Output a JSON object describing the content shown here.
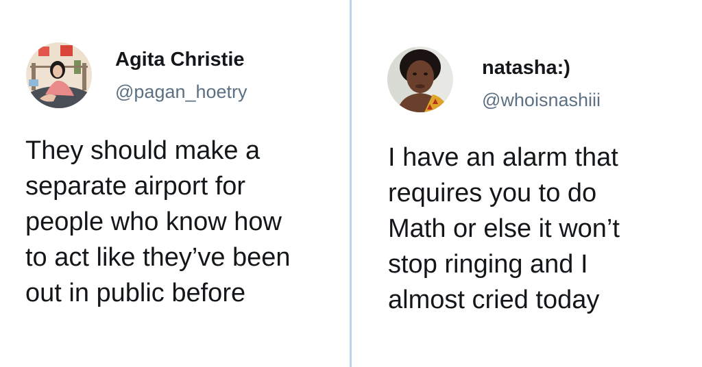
{
  "tweets": [
    {
      "display_name": "Agita Christie",
      "handle": "@pagan_hoetry",
      "avatar_icon": "profile-photo",
      "text_lines": [
        "They should make a",
        "separate airport for",
        "people who know how",
        "to act like they’ve been",
        "out in public before"
      ]
    },
    {
      "display_name": "natasha:)",
      "handle": "@whoisnashiii",
      "avatar_icon": "profile-photo",
      "text_lines": [
        "I have an alarm that",
        "requires you to do",
        "Math or else it won’t",
        "stop ringing and I",
        "almost cried today"
      ]
    }
  ],
  "colors": {
    "background": "#ffffff",
    "divider": "#bcd3ea",
    "name": "#14171a",
    "handle": "#5b7083",
    "body": "#14171a"
  }
}
